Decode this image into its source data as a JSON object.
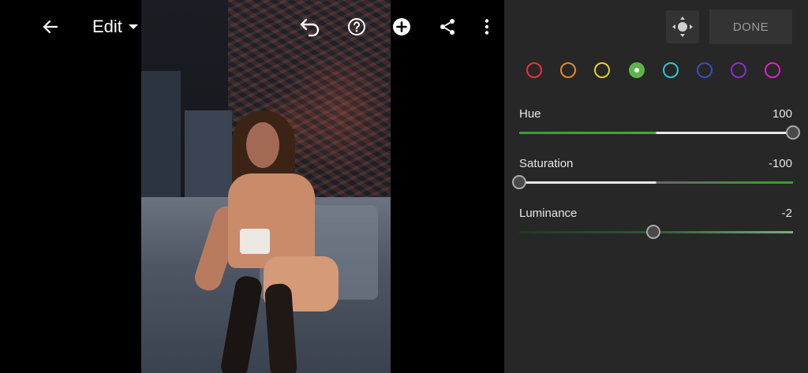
{
  "topbar": {
    "back_icon": "arrow-left-icon",
    "edit_label": "Edit",
    "undo_icon": "undo-icon",
    "help_icon": "help-circle-icon",
    "add_icon": "add-circle-icon",
    "share_icon": "share-icon",
    "more_icon": "more-vertical-icon"
  },
  "panel": {
    "target_icon": "targeted-adjustment-icon",
    "done_label": "DONE",
    "swatches": [
      {
        "name": "red",
        "color": "#e8323c",
        "selected": false
      },
      {
        "name": "orange",
        "color": "#e8862a",
        "selected": false
      },
      {
        "name": "yellow",
        "color": "#e3d229",
        "selected": false
      },
      {
        "name": "green",
        "color": "#5cb54a",
        "selected": true
      },
      {
        "name": "aqua",
        "color": "#2ec6d6",
        "selected": false
      },
      {
        "name": "blue",
        "color": "#3b4fb8",
        "selected": false
      },
      {
        "name": "purple",
        "color": "#8e2ad1",
        "selected": false
      },
      {
        "name": "magenta",
        "color": "#d824c6",
        "selected": false
      }
    ],
    "sliders": [
      {
        "label": "Hue",
        "value": "100",
        "fraction": 1.0
      },
      {
        "label": "Saturation",
        "value": "-100",
        "fraction": 0.0
      },
      {
        "label": "Luminance",
        "value": "-2",
        "fraction": 0.49
      }
    ]
  }
}
